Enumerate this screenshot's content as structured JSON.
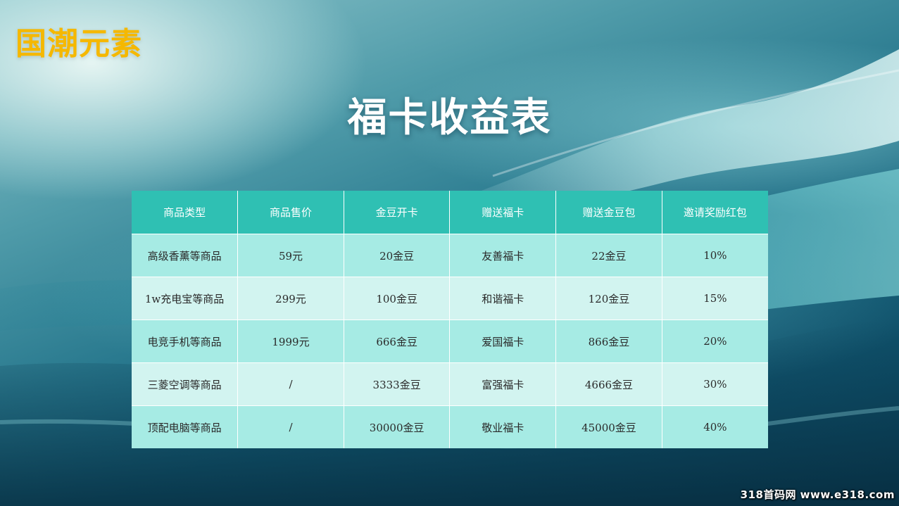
{
  "brand": {
    "text": "国潮元素",
    "color": "#f5b800"
  },
  "title": "福卡收益表",
  "table": {
    "header_color": "#2fc0b3",
    "row_colors": [
      "#a6ebe4",
      "#d2f4f0"
    ],
    "headers": [
      "商品类型",
      "商品售价",
      "金豆开卡",
      "赠送福卡",
      "赠送金豆包",
      "邀请奖励红包"
    ],
    "rows": [
      [
        "高级香薰等商品",
        "59元",
        "20金豆",
        "友善福卡",
        "22金豆",
        "10%"
      ],
      [
        "1w充电宝等商品",
        "299元",
        "100金豆",
        "和谐福卡",
        "120金豆",
        "15%"
      ],
      [
        "电竞手机等商品",
        "1999元",
        "666金豆",
        "爱国福卡",
        "866金豆",
        "20%"
      ],
      [
        "三菱空调等商品",
        "/",
        "3333金豆",
        "富强福卡",
        "4666金豆",
        "30%"
      ],
      [
        "顶配电脑等商品",
        "/",
        "30000金豆",
        "敬业福卡",
        "45000金豆",
        "40%"
      ]
    ]
  },
  "watermark": "318首码网 www.e318.com"
}
